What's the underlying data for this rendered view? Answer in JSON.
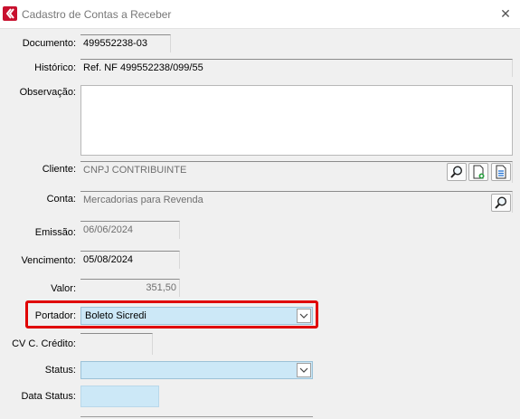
{
  "window": {
    "title": "Cadastro de Contas a Receber",
    "close_glyph": "✕"
  },
  "labels": {
    "documento": "Documento:",
    "historico": "Histórico:",
    "observacao": "Observação:",
    "cliente": "Cliente:",
    "conta": "Conta:",
    "emissao": "Emissão:",
    "vencimento": "Vencimento:",
    "valor": "Valor:",
    "portador": "Portador:",
    "cv_credito": "CV C. Crédito:",
    "status": "Status:",
    "data_status": "Data Status:"
  },
  "values": {
    "documento": "499552238-03",
    "historico": "Ref. NF 499552238/099/55",
    "observacao": "",
    "cliente": "CNPJ CONTRIBUINTE",
    "conta": "Mercadorias para Revenda",
    "emissao": "06/06/2024",
    "vencimento": "05/08/2024",
    "valor": "351,50",
    "portador": "Boleto Sicredi",
    "cv_credito": "",
    "status": "",
    "data_status": ""
  },
  "icons": {
    "app": "app-logo-icon",
    "search": "search-icon",
    "new_doc": "new-document-icon",
    "doc": "document-icon",
    "dropdown": "chevron-down-icon"
  },
  "colors": {
    "highlight": "#e00000",
    "combo_bg": "#cce8f7",
    "app_icon": "#c8102e"
  }
}
